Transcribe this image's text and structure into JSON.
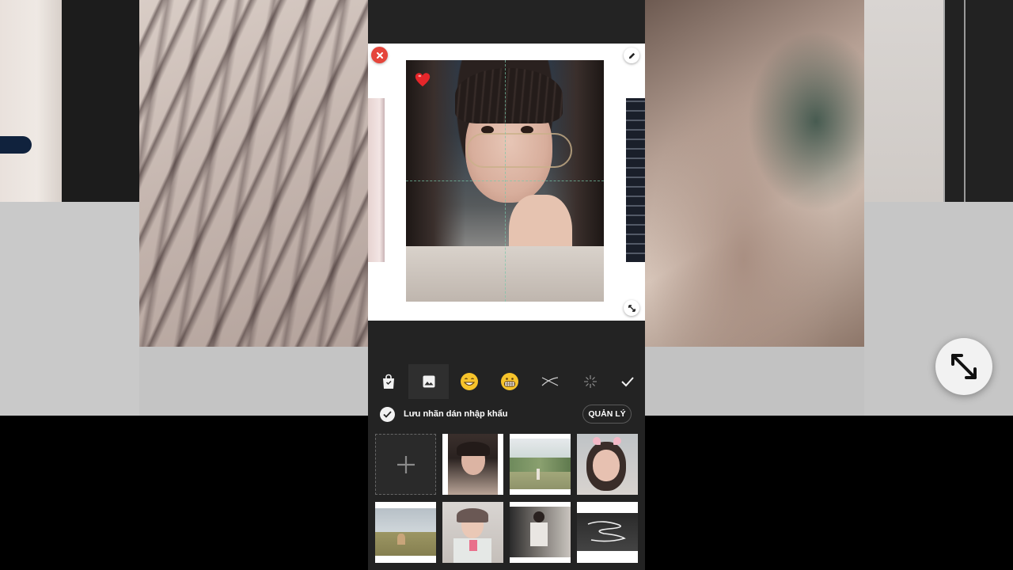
{
  "editor": {
    "import_toggle_label": "Lưu nhãn dán nhập khẩu",
    "manage_button_label": "QUẢN LÝ"
  },
  "toolbar": {
    "items": [
      {
        "icon": "shopping-bag-icon",
        "active": false
      },
      {
        "icon": "image-icon",
        "active": true
      },
      {
        "icon": "grinning-emoji-icon",
        "active": false
      },
      {
        "icon": "grimacing-emoji-icon",
        "active": false
      },
      {
        "icon": "scribble-icon",
        "active": false
      },
      {
        "icon": "sparkle-icon",
        "active": false
      },
      {
        "icon": "checkmark-icon",
        "active": false
      }
    ]
  },
  "sticker_grid": {
    "add_label": "+",
    "items": [
      {
        "name": "sticker-girl-glasses"
      },
      {
        "name": "sticker-field-landscape"
      },
      {
        "name": "sticker-girl-cat-ears"
      },
      {
        "name": "sticker-field-sky"
      },
      {
        "name": "sticker-girl-mirror"
      },
      {
        "name": "sticker-room-photo"
      },
      {
        "name": "sticker-scribble-text"
      }
    ]
  },
  "colors": {
    "panel_bg": "#232323",
    "close_red": "#e5453b",
    "accent_white": "#ffffff"
  }
}
